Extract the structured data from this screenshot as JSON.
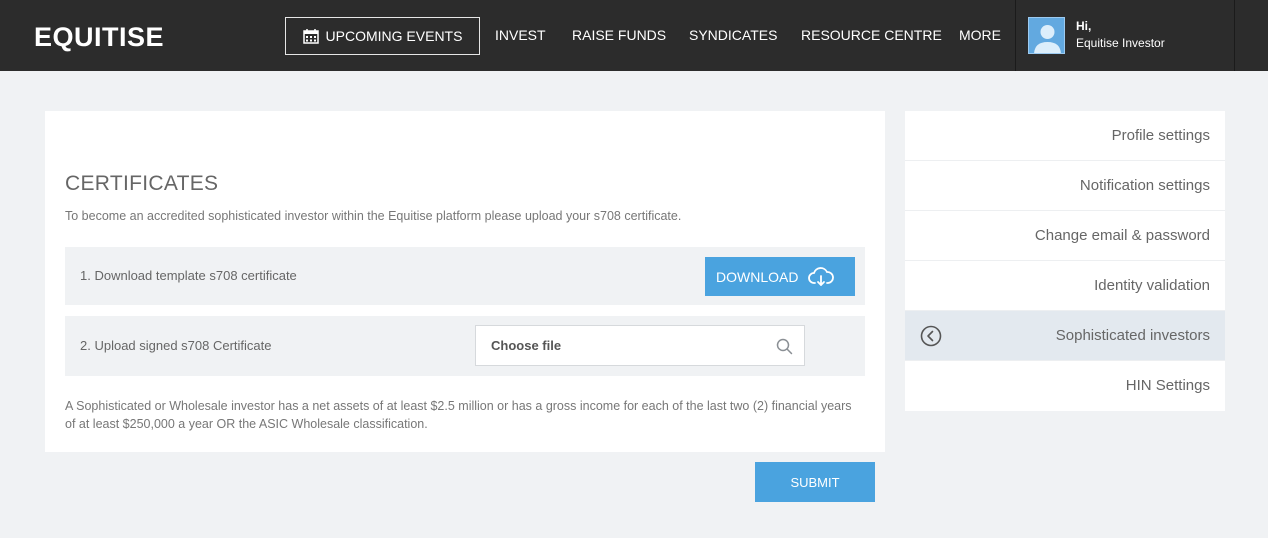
{
  "header": {
    "logo": "EQUITISE",
    "nav": {
      "upcoming_events": "UPCOMING EVENTS",
      "invest": "INVEST",
      "raise_funds": "RAISE FUNDS",
      "syndicates": "SYNDICATES",
      "resource_centre": "RESOURCE CENTRE",
      "more": "MORE"
    },
    "user": {
      "greeting": "Hi,",
      "name": "Equitise Investor"
    }
  },
  "certificates": {
    "title": "CERTIFICATES",
    "intro": "To become an accredited sophisticated investor within the Equitise platform please upload your s708 certificate.",
    "step1_label": "1. Download template s708 certificate",
    "download_label": "DOWNLOAD",
    "step2_label": "2. Upload signed s708 Certificate",
    "file_placeholder": "Choose file",
    "note": "A Sophisticated or Wholesale investor has a net assets of at least $2.5 million or has a gross income for each of the last two (2) financial years of at least $250,000 a year OR the ASIC Wholesale classification."
  },
  "submit_label": "SUBMIT",
  "side_menu": {
    "items": [
      {
        "label": "Profile settings",
        "active": false
      },
      {
        "label": "Notification settings",
        "active": false
      },
      {
        "label": "Change email & password",
        "active": false
      },
      {
        "label": "Identity validation",
        "active": false
      },
      {
        "label": "Sophisticated investors",
        "active": true
      },
      {
        "label": "HIN Settings",
        "active": false
      }
    ]
  },
  "icons": {
    "calendar": "calendar-icon",
    "cloud_download": "cloud-download-icon",
    "search": "search-icon",
    "back": "chevron-left-circle-icon",
    "avatar": "user-avatar-icon"
  },
  "colors": {
    "header_bg": "#2c2c2c",
    "accent": "#4aa3df",
    "page_bg": "#f0f2f4",
    "active_menu_bg": "#e3e9ef"
  }
}
